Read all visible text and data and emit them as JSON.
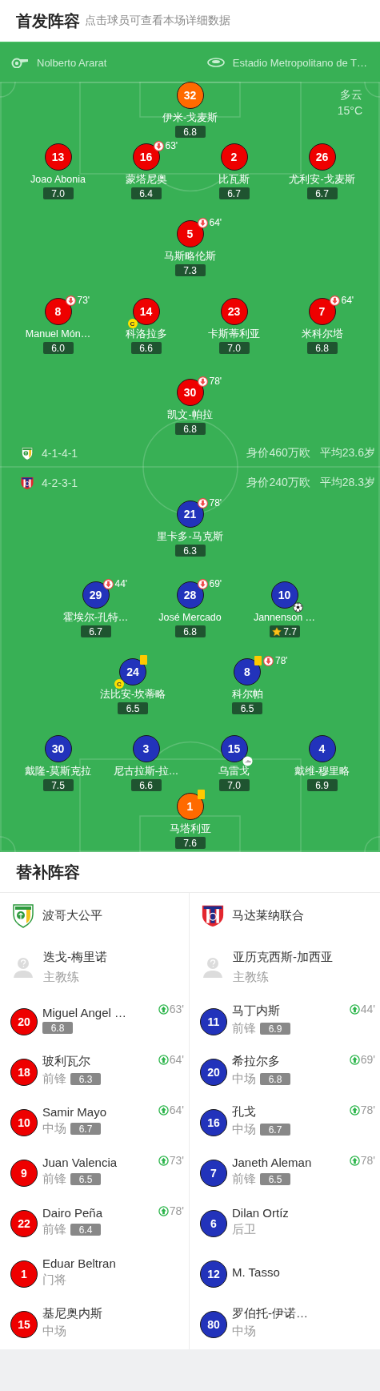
{
  "header": {
    "title": "首发阵容",
    "subtitle": "点击球员可查看本场详细数据"
  },
  "pitch": {
    "referee": "Nolberto Ararat",
    "stadium": "Estadio Metropolitano de T…",
    "weather": "多云",
    "temperature": "15°C",
    "home": {
      "formation": "4-1-4-1",
      "value": "身价460万欧",
      "age": "平均23.6岁",
      "rows": [
        [
          {
            "number": "32",
            "name": "伊米-戈麦斯",
            "rating": "6.8",
            "color": "#ff6a00"
          }
        ],
        [
          {
            "number": "13",
            "name": "Joao Abonia",
            "rating": "7.0",
            "color": "#ee0000"
          },
          {
            "number": "16",
            "name": "蒙塔尼奥",
            "rating": "6.4",
            "color": "#ee0000",
            "events": [
              {
                "kind": "sub_out",
                "minute": "63'"
              }
            ]
          },
          {
            "number": "2",
            "name": "比瓦斯",
            "rating": "6.7",
            "color": "#ee0000"
          },
          {
            "number": "26",
            "name": "尤利安-戈麦斯",
            "rating": "6.7",
            "color": "#ee0000"
          }
        ],
        [
          {
            "number": "5",
            "name": "马斯略伦斯",
            "rating": "7.3",
            "color": "#ee0000",
            "events": [
              {
                "kind": "sub_out",
                "minute": "64'"
              }
            ]
          }
        ],
        [
          {
            "number": "8",
            "name": "Manuel Món…",
            "rating": "6.0",
            "color": "#ee0000",
            "events": [
              {
                "kind": "sub_out",
                "minute": "73'"
              }
            ]
          },
          {
            "number": "14",
            "name": "科洛拉多",
            "rating": "6.6",
            "color": "#ee0000",
            "events": [
              {
                "kind": "captain",
                "label": "C"
              }
            ]
          },
          {
            "number": "23",
            "name": "卡斯蒂利亚",
            "rating": "7.0",
            "color": "#ee0000"
          },
          {
            "number": "7",
            "name": "米科尔塔",
            "rating": "6.8",
            "color": "#ee0000",
            "events": [
              {
                "kind": "sub_out",
                "minute": "64'"
              }
            ]
          }
        ],
        [
          {
            "number": "30",
            "name": "凯文-帕拉",
            "rating": "6.8",
            "color": "#ee0000",
            "events": [
              {
                "kind": "sub_out",
                "minute": "78'"
              }
            ]
          }
        ]
      ]
    },
    "away": {
      "formation": "4-2-3-1",
      "value": "身价240万欧",
      "age": "平均28.3岁",
      "rows": [
        [
          {
            "number": "21",
            "name": "里卡多-马克斯",
            "rating": "6.3",
            "color": "#2233bb",
            "events": [
              {
                "kind": "sub_out",
                "minute": "78'"
              }
            ]
          }
        ],
        [
          {
            "number": "29",
            "name": "霍埃尔-孔特…",
            "rating": "6.7",
            "color": "#2233bb",
            "events": [
              {
                "kind": "sub_out",
                "minute": "44'"
              }
            ]
          },
          {
            "number": "28",
            "name": "José Mercado",
            "rating": "6.8",
            "color": "#2233bb",
            "events": [
              {
                "kind": "sub_out",
                "minute": "69'"
              }
            ]
          },
          {
            "number": "10",
            "name": "Jannenson …",
            "rating": "7.7",
            "color": "#2233bb",
            "events": [
              {
                "kind": "goal"
              },
              {
                "kind": "best"
              }
            ]
          }
        ],
        [
          {
            "number": "24",
            "name": "法比安-坎蒂略",
            "rating": "6.5",
            "color": "#2233bb",
            "events": [
              {
                "kind": "yellow_card"
              },
              {
                "kind": "captain",
                "label": "C"
              }
            ]
          },
          {
            "number": "8",
            "name": "科尔帕",
            "rating": "6.5",
            "color": "#2233bb",
            "events": [
              {
                "kind": "yellow_card"
              },
              {
                "kind": "sub_out",
                "minute": "78'"
              }
            ]
          }
        ],
        [
          {
            "number": "30",
            "name": "戴隆-莫斯克拉",
            "rating": "7.5",
            "color": "#2233bb"
          },
          {
            "number": "3",
            "name": "尼古拉斯-拉…",
            "rating": "6.6",
            "color": "#2233bb"
          },
          {
            "number": "15",
            "name": "乌雷戈",
            "rating": "7.0",
            "color": "#2233bb",
            "events": [
              {
                "kind": "assist"
              }
            ]
          },
          {
            "number": "4",
            "name": "戴维-穆里略",
            "rating": "6.9",
            "color": "#2233bb"
          }
        ],
        [
          {
            "number": "1",
            "name": "马塔利亚",
            "rating": "7.6",
            "color": "#ff6a00",
            "events": [
              {
                "kind": "yellow_card"
              }
            ]
          }
        ]
      ]
    }
  },
  "subs": {
    "title": "替补阵容",
    "teams": [
      {
        "kind": "home",
        "team": "波哥大公平",
        "color": "#ee0000",
        "coach": {
          "name": "迭戈-梅里诺",
          "role": "主教练"
        },
        "players": [
          {
            "number": "20",
            "name": "Miguel Angel …",
            "rating": "6.8",
            "minute": "63'"
          },
          {
            "number": "18",
            "name": "玻利瓦尔",
            "position": "前锋",
            "rating": "6.3",
            "minute": "64'"
          },
          {
            "number": "10",
            "name": "Samir Mayo",
            "position": "中场",
            "rating": "6.7",
            "minute": "64'"
          },
          {
            "number": "9",
            "name": "Juan Valencia",
            "position": "前锋",
            "rating": "6.5",
            "minute": "73'"
          },
          {
            "number": "22",
            "name": "Dairo Peña",
            "position": "前锋",
            "rating": "6.4",
            "minute": "78'"
          },
          {
            "number": "1",
            "name": "Eduar Beltran",
            "position": "门将"
          },
          {
            "number": "15",
            "name": "基尼奥内斯",
            "position": "中场"
          }
        ]
      },
      {
        "kind": "away",
        "team": "马达莱纳联合",
        "color": "#2233bb",
        "coach": {
          "name": "亚历克西斯-加西亚",
          "role": "主教练"
        },
        "players": [
          {
            "number": "11",
            "name": "马丁内斯",
            "position": "前锋",
            "rating": "6.9",
            "minute": "44'"
          },
          {
            "number": "20",
            "name": "希拉尔多",
            "position": "中场",
            "rating": "6.8",
            "minute": "69'"
          },
          {
            "number": "16",
            "name": "孔戈",
            "position": "中场",
            "rating": "6.7",
            "minute": "78'"
          },
          {
            "number": "7",
            "name": "Janeth Aleman",
            "position": "前锋",
            "rating": "6.5",
            "minute": "78'"
          },
          {
            "number": "6",
            "name": "Dilan Ortíz",
            "position": "后卫"
          },
          {
            "number": "12",
            "name": "M. Tasso"
          },
          {
            "number": "80",
            "name": "罗伯托-伊诺…",
            "position": "中场"
          }
        ]
      }
    ]
  }
}
